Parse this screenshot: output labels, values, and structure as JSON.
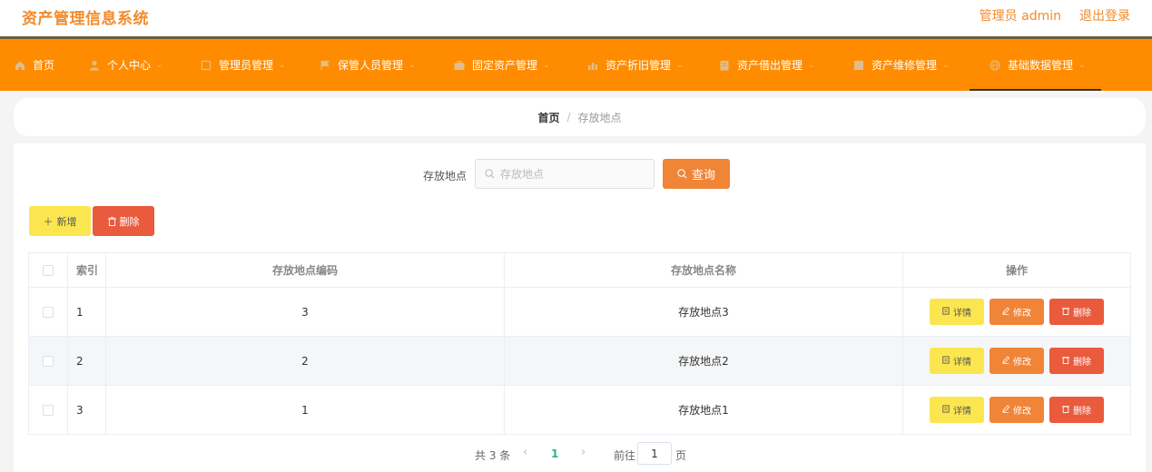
{
  "header": {
    "title": "资产管理信息系统",
    "user_label": "管理员 admin",
    "logout_label": "退出登录"
  },
  "nav": [
    {
      "label": "首页",
      "icon": "home-icon",
      "width": 82
    },
    {
      "label": "个人中心",
      "icon": "user-icon",
      "width": 121
    },
    {
      "label": "管理员管理",
      "icon": "admin-icon",
      "width": 133
    },
    {
      "label": "保管人员管理",
      "icon": "flag-icon",
      "width": 147
    },
    {
      "label": "固定资产管理",
      "icon": "briefcase-icon",
      "width": 146
    },
    {
      "label": "资产折旧管理",
      "icon": "chart-icon",
      "width": 147
    },
    {
      "label": "资产借出管理",
      "icon": "document-icon",
      "width": 146
    },
    {
      "label": "资产维修管理",
      "icon": "tool-icon",
      "width": 146
    },
    {
      "label": "基础数据管理",
      "icon": "globe-icon",
      "width": 145
    }
  ],
  "breadcrumb": {
    "home": "首页",
    "separator": "/",
    "current": "存放地点"
  },
  "search": {
    "label": "存放地点",
    "placeholder": "存放地点",
    "button_label": "查询"
  },
  "toolbar": {
    "add_label": "新增",
    "delete_label": "删除"
  },
  "table": {
    "columns": [
      "索引",
      "存放地点编码",
      "存放地点名称",
      "操作"
    ],
    "rows": [
      {
        "index": "1",
        "code": "3",
        "name": "存放地点3"
      },
      {
        "index": "2",
        "code": "2",
        "name": "存放地点2"
      },
      {
        "index": "3",
        "code": "1",
        "name": "存放地点1"
      }
    ],
    "actions": {
      "detail": "详情",
      "edit": "修改",
      "delete": "删除"
    }
  },
  "pagination": {
    "total_text": "共 3 条",
    "current_page": "1",
    "goto_label": "前往",
    "goto_value": "1",
    "page_unit": "页"
  },
  "colors": {
    "accent": "#ff8c00",
    "title": "#f28b2c",
    "query": "#f08437",
    "add": "#fce64f",
    "delete": "#ea5a3d",
    "active_page": "#2db67a"
  }
}
